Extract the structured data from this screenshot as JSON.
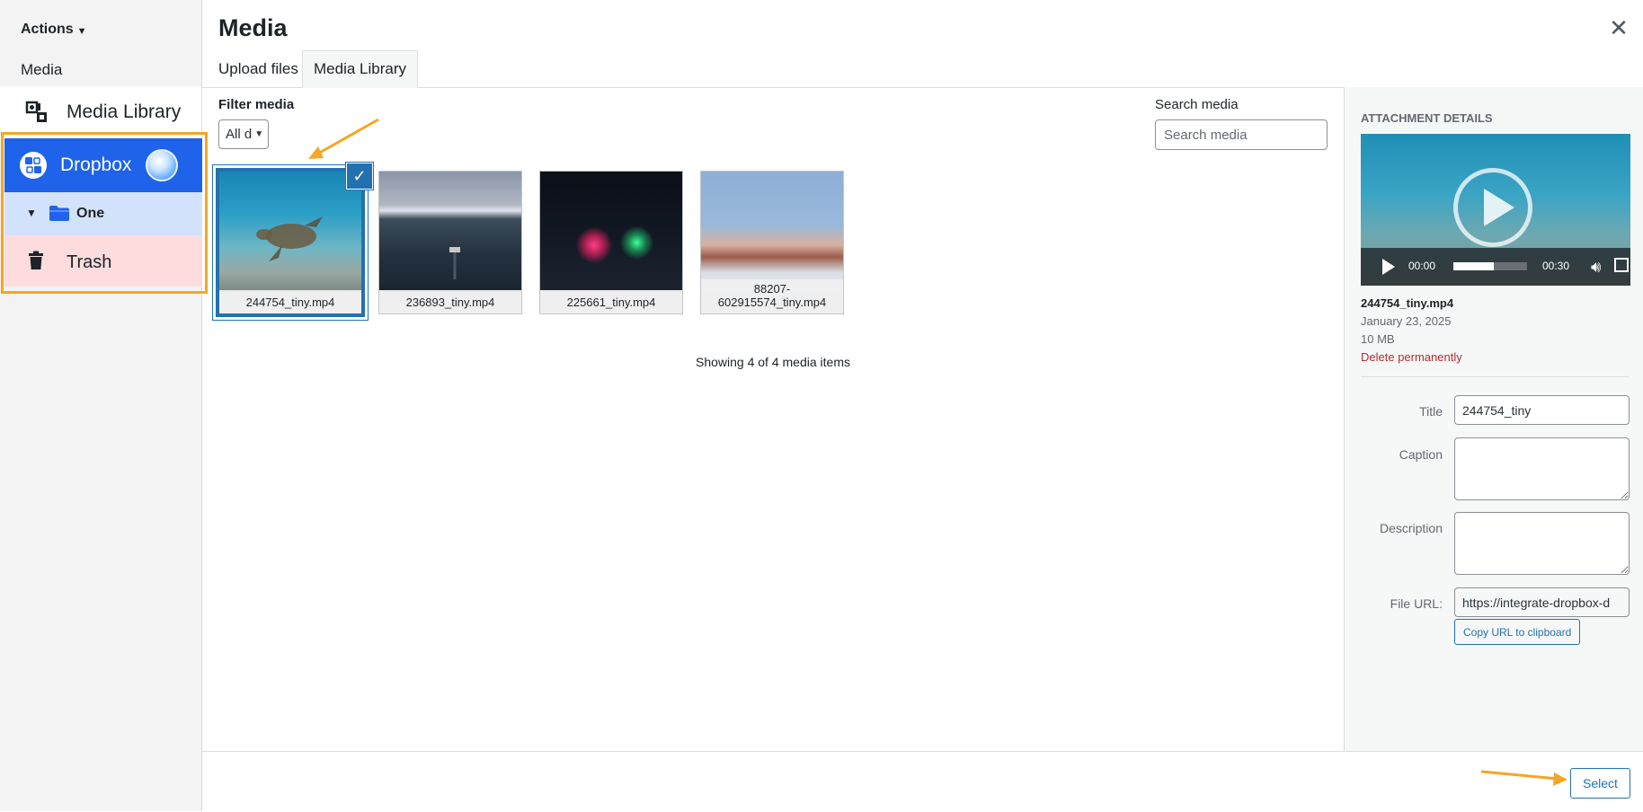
{
  "sidebar": {
    "actions_label": "Actions",
    "media_label": "Media",
    "media_library_label": "Media Library",
    "folders": [
      {
        "label": "Dropbox",
        "icon": "dropbox-app-icon",
        "color": "#1e63ea"
      },
      {
        "label": "One",
        "icon": "folder-icon",
        "color": "#d3e2fb"
      },
      {
        "label": "Trash",
        "icon": "trash-icon",
        "color": "#fcdcdc"
      }
    ]
  },
  "modal": {
    "title": "Media",
    "close_glyph": "✕",
    "tabs": [
      {
        "label": "Upload files",
        "active": false
      },
      {
        "label": "Media Library",
        "active": true
      }
    ]
  },
  "toolbar": {
    "filter_label": "Filter media",
    "filter_value": "All d",
    "search_label": "Search media",
    "search_placeholder": "Search media"
  },
  "media_items": [
    {
      "filename": "244754_tiny.mp4",
      "selected": true
    },
    {
      "filename": "236893_tiny.mp4",
      "selected": false
    },
    {
      "filename": "225661_tiny.mp4",
      "selected": false
    },
    {
      "filename": "88207-602915574_tiny.mp4",
      "filename_line1": "88207-",
      "filename_line2": "602915574_tiny.mp4",
      "selected": false
    }
  ],
  "showing_text": "Showing 4 of 4 media items",
  "details": {
    "heading": "Attachment details",
    "video": {
      "current_time": "00:00",
      "duration": "00:30",
      "progress_fraction": 0.55
    },
    "filename": "244754_tiny.mp4",
    "date": "January 23, 2025",
    "size": "10 MB",
    "delete_label": "Delete permanently",
    "fields": {
      "title_label": "Title",
      "title_value": "244754_tiny",
      "caption_label": "Caption",
      "caption_value": "",
      "description_label": "Description",
      "description_value": "",
      "file_url_label": "File URL:",
      "file_url_value": "https://integrate-dropbox-d"
    },
    "copy_url_label": "Copy URL to clipboard"
  },
  "footer": {
    "select_label": "Select"
  },
  "colors": {
    "accent": "#2271b1",
    "annotation": "#f5a623",
    "delete": "#b32d2e"
  }
}
